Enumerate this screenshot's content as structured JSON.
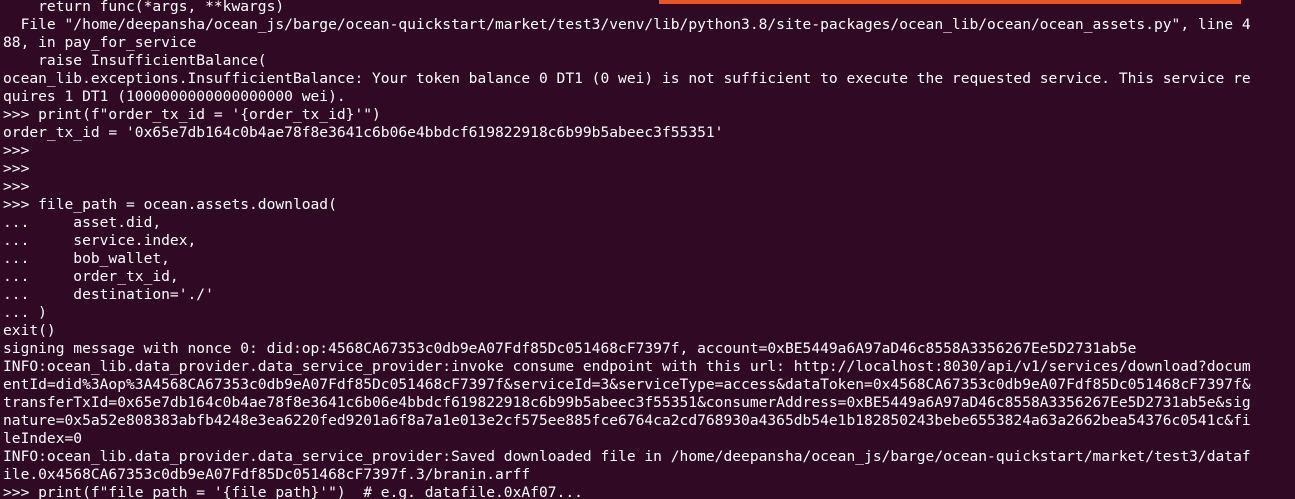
{
  "terminal": {
    "colors": {
      "background": "#300a24",
      "foreground": "#ffffff",
      "scroll_indicator": "#e95420"
    },
    "lines": [
      "    return func(*args, **kwargs)",
      "  File \"/home/deepansha/ocean_js/barge/ocean-quickstart/market/test3/venv/lib/python3.8/site-packages/ocean_lib/ocean/ocean_assets.py\", line 4",
      "88, in pay_for_service",
      "    raise InsufficientBalance(",
      "ocean_lib.exceptions.InsufficientBalance: Your token balance 0 DT1 (0 wei) is not sufficient to execute the requested service. This service re",
      "quires 1 DT1 (1000000000000000000 wei).",
      ">>> print(f\"order_tx_id = '{order_tx_id}'\")",
      "order_tx_id = '0x65e7db164c0b4ae78f8e3641c6b06e4bbdcf619822918c6b99b5abeec3f55351'",
      ">>>",
      ">>>",
      ">>>",
      ">>> file_path = ocean.assets.download(",
      "...     asset.did,",
      "...     service.index,",
      "...     bob_wallet,",
      "...     order_tx_id,",
      "...     destination='./'",
      "... )",
      "exit()",
      "signing message with nonce 0: did:op:4568CA67353c0db9eA07Fdf85Dc051468cF7397f, account=0xBE5449a6A97aD46c8558A3356267Ee5D2731ab5e",
      "INFO:ocean_lib.data_provider.data_service_provider:invoke consume endpoint with this url: http://localhost:8030/api/v1/services/download?docum",
      "entId=did%3Aop%3A4568CA67353c0db9eA07Fdf85Dc051468cF7397f&serviceId=3&serviceType=access&dataToken=0x4568CA67353c0db9eA07Fdf85Dc051468cF7397f&",
      "transferTxId=0x65e7db164c0b4ae78f8e3641c6b06e4bbdcf619822918c6b99b5abeec3f55351&consumerAddress=0xBE5449a6A97aD46c8558A3356267Ee5D2731ab5e&sig",
      "nature=0x5a52e808383abfb4248e3ea6220fed9201a6f8a7a1e013e2cf575ee885fce6764ca2cd768930a4365db54e1b182850243bebe6553824a63a2662bea54376c0541c&fi",
      "leIndex=0",
      "INFO:ocean_lib.data_provider.data_service_provider:Saved downloaded file in /home/deepansha/ocean_js/barge/ocean-quickstart/market/test3/dataf",
      "ile.0x4568CA67353c0db9eA07Fdf85Dc051468cF7397f.3/branin.arff",
      ">>> print(f\"file_path = '{file_path}'\")  # e.g. datafile.0xAf07..."
    ]
  }
}
